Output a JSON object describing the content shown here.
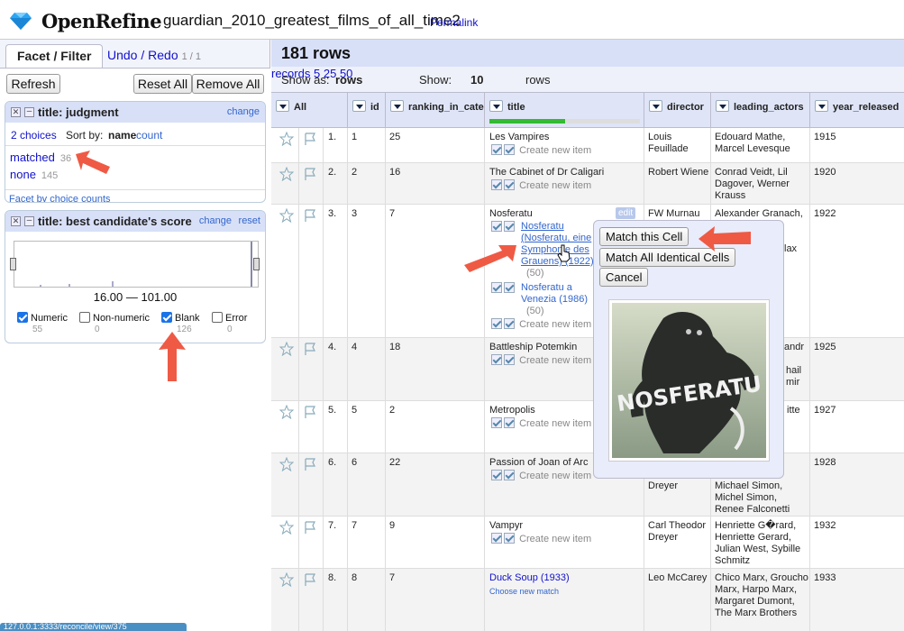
{
  "header": {
    "app_name": "OpenRefine",
    "project_name": "guardian_2010_greatest_films_of_all_time2",
    "permalink": "Permalink"
  },
  "left": {
    "tabs": {
      "facet": "Facet / Filter",
      "undo": "Undo / Redo",
      "undo_count": "1 / 1"
    },
    "buttons": {
      "refresh": "Refresh",
      "reset_all": "Reset All",
      "remove_all": "Remove All"
    },
    "facet1": {
      "title": "title: judgment",
      "change": "change",
      "choices": "2 choices",
      "sort_by": "Sort by:",
      "sort_name": "name",
      "sort_count": "count",
      "items": [
        {
          "label": "matched",
          "count": "36"
        },
        {
          "label": "none",
          "count": "145"
        }
      ],
      "facet_by": "Facet by choice counts"
    },
    "facet2": {
      "title": "title: best candidate's score",
      "change": "change",
      "reset": "reset",
      "range": "16.00 — 101.00",
      "checks": [
        {
          "label": "Numeric",
          "count": "55",
          "checked": true
        },
        {
          "label": "Non-numeric",
          "count": "0",
          "checked": false
        },
        {
          "label": "Blank",
          "count": "126",
          "checked": true
        },
        {
          "label": "Error",
          "count": "0",
          "checked": false
        }
      ]
    }
  },
  "main": {
    "rows_count": "181 rows",
    "show_as": "Show as:",
    "rows_link": "rows",
    "records_link": "records",
    "show": "Show:",
    "sizes": [
      "5",
      "10",
      "25",
      "50"
    ],
    "rows_word": "rows",
    "columns": [
      "All",
      "id",
      "ranking_in_cate",
      "title",
      "director",
      "leading_actors",
      "year_released"
    ],
    "progress": 0.5,
    "create_new": "Create new item",
    "choose_new": "Choose new match",
    "edit": "edit",
    "rows": [
      {
        "num": "1.",
        "id": "1",
        "rank": "25",
        "title": "Les Vampires",
        "director": "Louis Feuillade",
        "actors": "Edouard Mathe, Marcel Levesque",
        "year": "1915"
      },
      {
        "num": "2.",
        "id": "2",
        "rank": "16",
        "title": "The Cabinet of Dr Caligari",
        "director": "Robert Wiene",
        "actors": "Conrad Veidt, Lil Dagover, Werner Krauss",
        "year": "1920"
      },
      {
        "num": "3.",
        "id": "3",
        "rank": "7",
        "title": "Nosferatu",
        "director": "FW Murnau",
        "actors": "Alexander Granach,",
        "year": "1922",
        "cand1": "Nosferatu (Nosferatu, eine Symphonie des Grauens) (1922)",
        "cand1_score": "(50)",
        "cand2": "Nosferatu a Venezia (1986)",
        "cand2_score": "(50)",
        "actors_extra": "lax"
      },
      {
        "num": "4.",
        "id": "4",
        "rank": "18",
        "title": "Battleship Potemkin",
        "director": "",
        "actors": "andr",
        "actors2": "hail",
        "actors3": "mir",
        "year": "1925"
      },
      {
        "num": "5.",
        "id": "5",
        "rank": "2",
        "title": "Metropolis",
        "director": "",
        "actors": "itte",
        "year": "1927"
      },
      {
        "num": "6.",
        "id": "6",
        "rank": "22",
        "title": "Passion of Joan of Arc",
        "director": "Dreyer",
        "actors": "Michael Simon, Michel Simon, Renee Falconetti",
        "year": "1928"
      },
      {
        "num": "7.",
        "id": "7",
        "rank": "9",
        "title": "Vampyr",
        "director": "Carl Theodor Dreyer",
        "actors": "Henriette G�rard, Henriette Gerard, Julian West, Sybille Schmitz",
        "year": "1932"
      },
      {
        "num": "8.",
        "id": "8",
        "rank": "7",
        "title": "Duck Soup (1933)",
        "director": "Leo McCarey",
        "actors": "Chico Marx, Groucho Marx, Harpo Marx, Margaret Dumont, The Marx Brothers",
        "year": "1933"
      }
    ]
  },
  "popup": {
    "match_cell": "Match this Cell",
    "match_all": "Match All Identical Cells",
    "cancel": "Cancel",
    "poster_text": "NOSFERATU"
  },
  "status": "127.0.0.1:3333/reconcile/view/375",
  "colors": {
    "accent": "#11c",
    "header_bg": "#d8e0f8",
    "arrow": "#ef5a45"
  }
}
